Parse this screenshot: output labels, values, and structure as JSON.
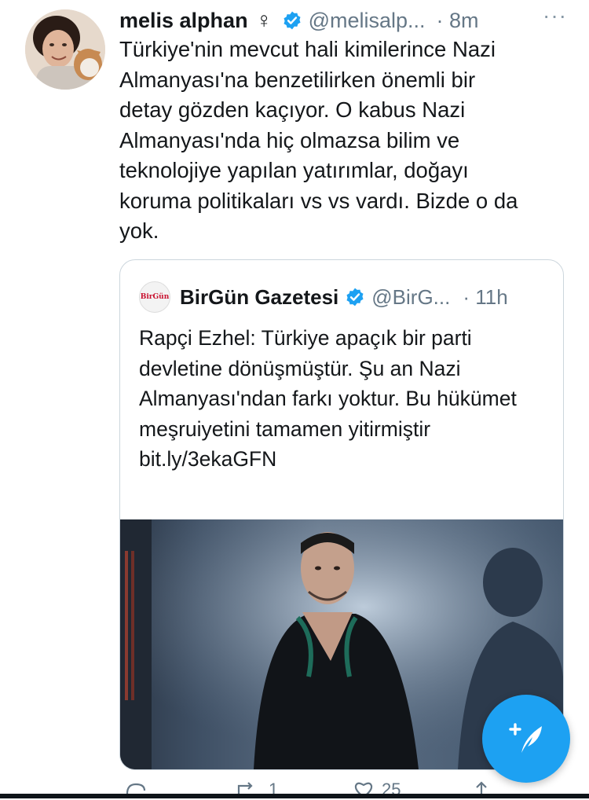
{
  "tweet": {
    "display_name": "melis alphan",
    "gender_symbol": "♀",
    "handle": "@melisalp...",
    "time": "· 8m",
    "more": "···",
    "text": "Türkiye'nin mevcut hali kimilerince Nazi\nAlmanyası'na benzetilirken önemli bir\ndetay gözden kaçıyor. O kabus Nazi\nAlmanyası'nda hiç olmazsa bilim ve\nteknolojiye yapılan yatırımlar, doğayı\nkoruma politikaları vs vs vardı. Bizde o da\nyok."
  },
  "quoted": {
    "logo_text": "BirGün",
    "display_name": "BirGün Gazetesi",
    "handle": "@BirG...",
    "time": "· 11h",
    "text": "Rapçi Ezhel: Türkiye apaçık bir parti devletine dönüşmüştür. Şu an Nazi Almanyası'ndan farkı yoktur. Bu hükümet meşruiyetini tamamen yitirmiştir",
    "link": "bit.ly/3ekaGFN"
  },
  "actions": {
    "retweet_count": "1",
    "like_count": "25"
  },
  "colors": {
    "accent": "#1da1f2",
    "text": "#14171a",
    "secondary_text": "#657786",
    "border": "#ccd6dd"
  },
  "icons": {
    "verified": "verified-badge-icon",
    "compose": "compose-tweet-icon",
    "reply": "reply-icon",
    "retweet": "retweet-icon",
    "like": "like-icon",
    "share": "share-icon"
  }
}
